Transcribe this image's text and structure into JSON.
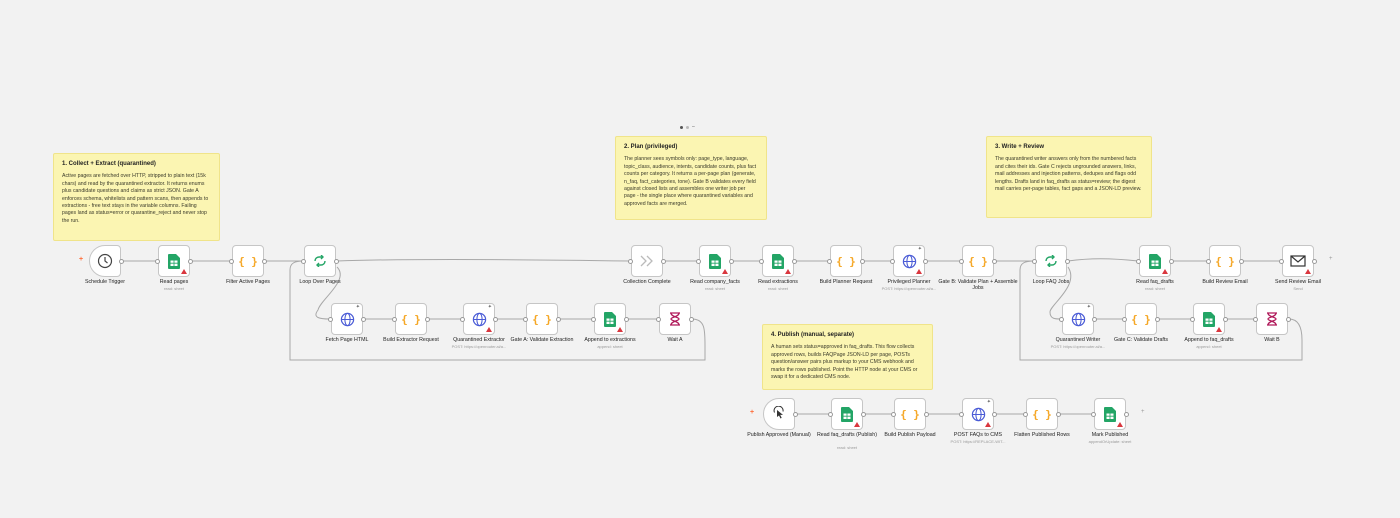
{
  "pager": {
    "items": [
      "1",
      "2",
      "3"
    ],
    "active": 0
  },
  "colors": {
    "canvas": "#f2f2f2",
    "sticky": "#fbf5b2",
    "sheets_green": "#23a566",
    "code_orange": "#f5a623",
    "http_blue": "#4a5bd6",
    "warning_red": "#d9363e",
    "trigger_orange": "#ff6d3a"
  },
  "stickies": [
    {
      "id": "collect",
      "title": "1. Collect + Extract (quarantined)",
      "body": "Active pages are fetched over HTTP, stripped to plain text (15k chars) and read by the quarantined extractor. It returns enums plus candidate questions and claims as strict JSON. Gate A enforces schema, whitelists and pattern scans, then appends to extractions - free text stays in the variable columns. Failing pages land as status=error or quarantine_reject and never stop the run."
    },
    {
      "id": "plan",
      "title": "2. Plan (privileged)",
      "body": "The planner sees symbols only: page_type, language, topic_class, audience, intents, candidate counts, plus fact counts per category. It returns a per-page plan (generate, n_faq, fact_categories, tone). Gate B validates every field against closed lists and assembles one writer job per page - the single place where quarantined variables and approved facts are merged."
    },
    {
      "id": "write",
      "title": "3. Write + Review",
      "body": "The quarantined writer answers only from the numbered facts and cites their ids. Gate C rejects ungrounded answers, links, mail addresses and injection patterns, dedupes and flags odd lengths. Drafts land in faq_drafts as status=review; the digest mail carries per-page tables, fact gaps and a JSON-LD preview."
    },
    {
      "id": "publish",
      "title": "4. Publish (manual, separate)",
      "body": "A human sets status=approved in faq_drafts. This flow collects approved rows, builds FAQPage JSON-LD per page, POSTs question/answer pairs plus markup to your CMS webhook and marks the rows published. Point the HTTP node at your CMS or swap it for a dedicated CMS node."
    }
  ],
  "nodes": [
    {
      "id": "schedule",
      "label": "Schedule Trigger",
      "sub": "",
      "icon": "clock-icon"
    },
    {
      "id": "readpages",
      "label": "Read pages",
      "sub": "read: sheet",
      "icon": "sheets-icon"
    },
    {
      "id": "filter",
      "label": "Filter Active Pages",
      "sub": "",
      "icon": "code-icon"
    },
    {
      "id": "loop",
      "label": "Loop Over Pages",
      "sub": "",
      "icon": "loop-icon"
    },
    {
      "id": "fetch",
      "label": "Fetch Page HTML",
      "sub": "",
      "icon": "globe-icon"
    },
    {
      "id": "buildext",
      "label": "Build Extractor Request",
      "sub": "",
      "icon": "code-icon"
    },
    {
      "id": "qextractor",
      "label": "Quarantined Extractor",
      "sub": "POST: https://openrouter.ai/a...",
      "icon": "globe-icon"
    },
    {
      "id": "gatea",
      "label": "Gate A: Validate Extraction",
      "sub": "",
      "icon": "code-icon"
    },
    {
      "id": "appendext",
      "label": "Append to extractions",
      "sub": "append: sheet",
      "icon": "sheets-icon"
    },
    {
      "id": "waita",
      "label": "Wait A",
      "sub": "",
      "icon": "hourglass-icon"
    },
    {
      "id": "collection",
      "label": "Collection Complete",
      "sub": "",
      "icon": "arrow-icon"
    },
    {
      "id": "readfacts",
      "label": "Read company_facts",
      "sub": "read: sheet",
      "icon": "sheets-icon"
    },
    {
      "id": "readextr",
      "label": "Read extractions",
      "sub": "read: sheet",
      "icon": "sheets-icon"
    },
    {
      "id": "buildplan",
      "label": "Build Planner Request",
      "sub": "",
      "icon": "code-icon"
    },
    {
      "id": "privplanner",
      "label": "Privileged Planner",
      "sub": "POST: https://openrouter.ai/a...",
      "icon": "globe-icon"
    },
    {
      "id": "gateb",
      "label": "Gate B: Validate Plan + Assemble Jobs",
      "sub": "",
      "icon": "code-icon"
    },
    {
      "id": "loopfaq",
      "label": "Loop FAQ Jobs",
      "sub": "",
      "icon": "loop-icon"
    },
    {
      "id": "qwriter",
      "label": "Quarantined Writer",
      "sub": "POST: https://openrouter.ai/a...",
      "icon": "globe-icon"
    },
    {
      "id": "gatec",
      "label": "Gate C: Validate Drafts",
      "sub": "",
      "icon": "code-icon"
    },
    {
      "id": "appenddrafts",
      "label": "Append to faq_drafts",
      "sub": "append: sheet",
      "icon": "sheets-icon"
    },
    {
      "id": "waitb",
      "label": "Wait B",
      "sub": "",
      "icon": "hourglass-icon"
    },
    {
      "id": "readdrafts",
      "label": "Read faq_drafts",
      "sub": "read: sheet",
      "icon": "sheets-icon"
    },
    {
      "id": "buildemail",
      "label": "Build Review Email",
      "sub": "",
      "icon": "code-icon"
    },
    {
      "id": "sendemail",
      "label": "Send Review Email",
      "sub": "Send",
      "icon": "mail-icon"
    },
    {
      "id": "publishapproved",
      "label": "Publish Approved (Manual)",
      "sub": "",
      "icon": "pointer-icon"
    },
    {
      "id": "readdraftspub",
      "label": "Read faq_drafts (Publish)",
      "sub": "read: sheet",
      "icon": "sheets-icon"
    },
    {
      "id": "buildpayload",
      "label": "Build Publish Payload",
      "sub": "",
      "icon": "code-icon"
    },
    {
      "id": "postcms",
      "label": "POST FAQs to CMS",
      "sub": "POST: https://REPLACE-WIT...",
      "icon": "globe-icon"
    },
    {
      "id": "flatten",
      "label": "Flatten Published Rows",
      "sub": "",
      "icon": "code-icon"
    },
    {
      "id": "markpub",
      "label": "Mark Published",
      "sub": "appendOrUpdate: sheet",
      "icon": "sheets-icon"
    }
  ]
}
